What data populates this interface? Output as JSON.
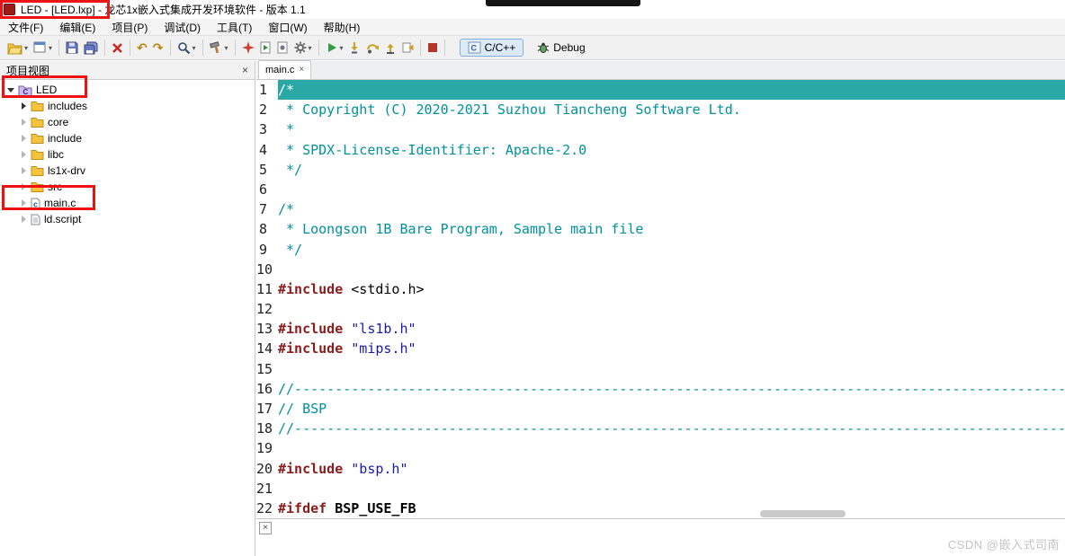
{
  "colors": {
    "annotation": "#EE1111",
    "line_highlight": "#2AA7A7",
    "comment": "#00919B",
    "directive": "#8B1C1C",
    "string": "#1A1AA6",
    "plain": "#000000",
    "macro": "#000000"
  },
  "window": {
    "title": "LED - [LED.lxp] - 龙芯1x嵌入式集成开发环境软件 - 版本 1.1"
  },
  "menu": {
    "items": [
      "文件(F)",
      "编辑(E)",
      "项目(P)",
      "调试(D)",
      "工具(T)",
      "窗口(W)",
      "帮助(H)"
    ]
  },
  "toolbar": {
    "groups": [
      {
        "buttons": [
          {
            "name": "open",
            "icon": "folder-open",
            "dropdown": true
          },
          {
            "name": "new",
            "icon": "new-win",
            "dropdown": true
          }
        ]
      },
      {
        "buttons": [
          {
            "name": "save",
            "icon": "save"
          },
          {
            "name": "save-all",
            "icon": "save-all"
          }
        ]
      },
      {
        "buttons": [
          {
            "name": "delete",
            "icon": "red-x"
          }
        ]
      },
      {
        "buttons": [
          {
            "name": "undo",
            "icon": "undo"
          },
          {
            "name": "redo",
            "icon": "redo"
          }
        ]
      },
      {
        "buttons": [
          {
            "name": "search",
            "icon": "search",
            "dropdown": true
          }
        ]
      },
      {
        "buttons": [
          {
            "name": "build",
            "icon": "build",
            "dropdown": true
          }
        ]
      },
      {
        "buttons": [
          {
            "name": "debug-flash",
            "icon": "flash"
          },
          {
            "name": "run-config",
            "icon": "doc-run"
          },
          {
            "name": "tool-config",
            "icon": "doc-gear"
          },
          {
            "name": "external-tools",
            "icon": "gear",
            "dropdown": true
          }
        ]
      },
      {
        "buttons": [
          {
            "name": "run",
            "icon": "run",
            "dropdown": true
          },
          {
            "name": "step-into",
            "icon": "step-into"
          },
          {
            "name": "step-over",
            "icon": "step-over"
          },
          {
            "name": "step-return",
            "icon": "step-return"
          },
          {
            "name": "instruction-step",
            "icon": "i-step"
          }
        ]
      },
      {
        "buttons": [
          {
            "name": "stop",
            "icon": "stop"
          }
        ]
      }
    ],
    "perspectives": [
      {
        "label": "C/C++",
        "icon": "cpp",
        "active": true
      },
      {
        "label": "Debug",
        "icon": "bug",
        "active": false
      }
    ]
  },
  "project_panel": {
    "title": "项目视图",
    "close": "×",
    "tree": [
      {
        "label": "LED",
        "icon": "project",
        "arrow": "down",
        "level": 0
      },
      {
        "label": "includes",
        "icon": "folder",
        "arrow": "right-dark",
        "level": 1
      },
      {
        "label": "core",
        "icon": "folder",
        "arrow": "right",
        "level": 1
      },
      {
        "label": "include",
        "icon": "folder",
        "arrow": "right",
        "level": 1
      },
      {
        "label": "libc",
        "icon": "folder",
        "arrow": "right",
        "level": 1
      },
      {
        "label": "ls1x-drv",
        "icon": "folder",
        "arrow": "right",
        "level": 1
      },
      {
        "label": "src",
        "icon": "folder",
        "arrow": "right",
        "level": 1
      },
      {
        "label": "main.c",
        "icon": "file-c",
        "arrow": "right",
        "level": 1
      },
      {
        "label": "ld.script",
        "icon": "file",
        "arrow": "right",
        "level": 1
      }
    ]
  },
  "editor": {
    "tab": "main.c",
    "tab_close": "×",
    "lines": [
      {
        "n": 1,
        "hl": true,
        "toks": [
          {
            "s": "comment",
            "t": "/*"
          }
        ]
      },
      {
        "n": 2,
        "toks": [
          {
            "s": "comment",
            "t": " * Copyright (C) 2020-2021 Suzhou Tiancheng Software Ltd."
          }
        ]
      },
      {
        "n": 3,
        "toks": [
          {
            "s": "comment",
            "t": " *"
          }
        ]
      },
      {
        "n": 4,
        "toks": [
          {
            "s": "comment",
            "t": " * SPDX-License-Identifier: Apache-2.0"
          }
        ]
      },
      {
        "n": 5,
        "toks": [
          {
            "s": "comment",
            "t": " */"
          }
        ]
      },
      {
        "n": 6,
        "toks": []
      },
      {
        "n": 7,
        "toks": [
          {
            "s": "comment",
            "t": "/*"
          }
        ]
      },
      {
        "n": 8,
        "toks": [
          {
            "s": "comment",
            "t": " * Loongson 1B Bare Program, Sample main file"
          }
        ]
      },
      {
        "n": 9,
        "toks": [
          {
            "s": "comment",
            "t": " */"
          }
        ]
      },
      {
        "n": 10,
        "toks": []
      },
      {
        "n": 11,
        "toks": [
          {
            "s": "directive",
            "t": "#include"
          },
          {
            "s": "plain",
            "t": " <stdio.h>"
          }
        ]
      },
      {
        "n": 12,
        "toks": []
      },
      {
        "n": 13,
        "toks": [
          {
            "s": "directive",
            "t": "#include"
          },
          {
            "s": "plain",
            "t": " "
          },
          {
            "s": "string",
            "t": "\"ls1b.h\""
          }
        ]
      },
      {
        "n": 14,
        "toks": [
          {
            "s": "directive",
            "t": "#include"
          },
          {
            "s": "plain",
            "t": " "
          },
          {
            "s": "string",
            "t": "\"mips.h\""
          }
        ]
      },
      {
        "n": 15,
        "toks": []
      },
      {
        "n": 16,
        "toks": [
          {
            "s": "comment",
            "t": "//----------------------------------------------------------------------------------------------------------------"
          }
        ]
      },
      {
        "n": 17,
        "toks": [
          {
            "s": "comment",
            "t": "// BSP"
          }
        ]
      },
      {
        "n": 18,
        "toks": [
          {
            "s": "comment",
            "t": "//----------------------------------------------------------------------------------------------------------------"
          }
        ]
      },
      {
        "n": 19,
        "toks": []
      },
      {
        "n": 20,
        "toks": [
          {
            "s": "directive",
            "t": "#include"
          },
          {
            "s": "plain",
            "t": " "
          },
          {
            "s": "string",
            "t": "\"bsp.h\""
          }
        ]
      },
      {
        "n": 21,
        "toks": []
      },
      {
        "n": 22,
        "toks": [
          {
            "s": "directive",
            "t": "#ifdef"
          },
          {
            "s": "macro",
            "t": " BSP_USE_FB"
          }
        ]
      }
    ]
  },
  "bottom_panel": {
    "close": "×"
  },
  "watermark": "CSDN @嵌入式司南"
}
